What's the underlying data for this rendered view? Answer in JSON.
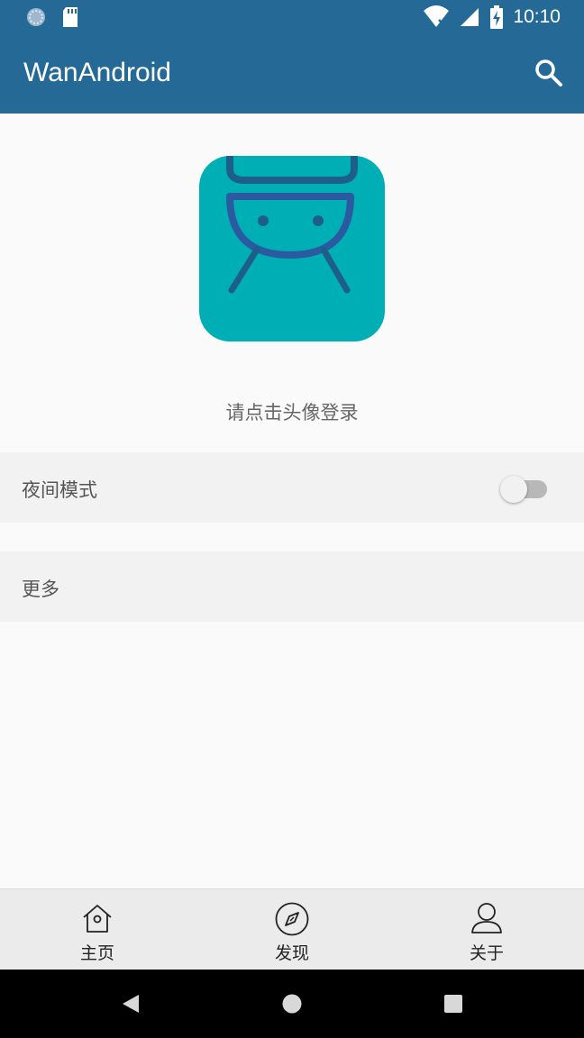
{
  "status_bar": {
    "time": "10:10"
  },
  "app_bar": {
    "title": "WanAndroid"
  },
  "profile": {
    "login_prompt": "请点击头像登录"
  },
  "settings": {
    "night_mode_label": "夜间模式",
    "night_mode_enabled": false,
    "more_label": "更多"
  },
  "bottom_nav": {
    "items": [
      {
        "label": "主页"
      },
      {
        "label": "发现"
      },
      {
        "label": "关于"
      }
    ]
  },
  "colors": {
    "primary": "#256a96",
    "avatar_bg": "#00aeb6",
    "avatar_figure": "#2b5aa0"
  }
}
